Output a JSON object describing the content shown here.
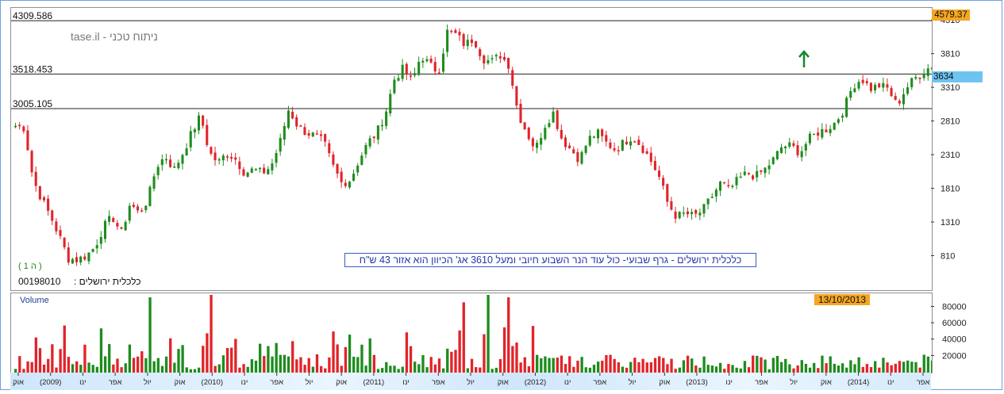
{
  "chart_data": [
    {
      "type": "candlestick",
      "title": "כלכלית ירושלים - גרף שבועי- כול עוד הנר השבוע חיובי ומעל 3610 אג' הכיוון הוא אזור 43 ש\"ח",
      "stock_name": "כלכלית ירושלים :",
      "stock_code": "00198010",
      "watermark": "ניתוח טכני - tase.il",
      "series_label": "( 1 ה )",
      "y_ticks": [
        810,
        1310,
        1810,
        2310,
        2810,
        3310,
        3810,
        4310
      ],
      "ylim": [
        310,
        4500
      ],
      "x_ticks": [
        "אוק",
        "(2009)",
        "ינו",
        "אפר",
        "יול",
        "אוק",
        "(2010)",
        "ינו",
        "אפר",
        "יול",
        "אוק",
        "(2011)",
        "ינו",
        "אפר",
        "יול",
        "אוק",
        "(2012)",
        "ינו",
        "אפר",
        "יול",
        "אוק",
        "(2013)",
        "ינו",
        "אפר",
        "יול",
        "אוק",
        "(2014)",
        "ינו",
        "אפר"
      ],
      "support_resistance_lines": [
        {
          "label": "4309.586",
          "value": 4309.586
        },
        {
          "label": "3518.453",
          "value": 3518.453
        },
        {
          "label": "3005.105",
          "value": 3005.105
        }
      ],
      "annotations": {
        "high_badge": "4579.37",
        "last_price_badge": "3634",
        "date_badge": "13/10/2013"
      },
      "close_path": [
        2750,
        2720,
        1950,
        1650,
        1400,
        1100,
        780,
        760,
        820,
        950,
        1250,
        1400,
        1150,
        1600,
        1450,
        1650,
        2150,
        2300,
        2100,
        2350,
        2650,
        2900,
        2350,
        2200,
        2350,
        2250,
        2050,
        2100,
        2050,
        2150,
        2500,
        3000,
        2750,
        2650,
        2600,
        2500,
        2150,
        1900,
        1950,
        2250,
        2500,
        2650,
        2950,
        3450,
        3600,
        3400,
        3800,
        3650,
        3550,
        4150,
        4100,
        3950,
        4050,
        3750,
        3700,
        3800,
        3650,
        2950,
        2650,
        2400,
        2750,
        2950,
        2550,
        2400,
        2250,
        2550,
        2650,
        2500,
        2400,
        2500,
        2600,
        2450,
        2250,
        2000,
        1600,
        1400,
        1450,
        1400,
        1500,
        1700,
        1900,
        1800,
        1950,
        2050,
        2000,
        2100,
        2250,
        2450,
        2450,
        2350,
        2550,
        2650,
        2700,
        2800,
        3000,
        3350,
        3450,
        3300,
        3350,
        3300,
        3050,
        3300,
        3450,
        3550,
        3650
      ]
    },
    {
      "type": "bar",
      "title": "Volume",
      "y_ticks": [
        "80000",
        "60000",
        "40000",
        "20000"
      ],
      "ylim": [
        0,
        95000
      ],
      "values_peak": [
        {
          "index": 33,
          "value": 92000
        },
        {
          "index": 48,
          "value": 95000
        },
        {
          "index": 110,
          "value": 86000
        },
        {
          "index": 116,
          "value": 95000
        },
        {
          "index": 121,
          "value": 92000
        }
      ]
    }
  ],
  "colors": {
    "up": "#1e8c1e",
    "down": "#e0242a",
    "level_line": "#222222",
    "arrow": "#138a2f"
  }
}
